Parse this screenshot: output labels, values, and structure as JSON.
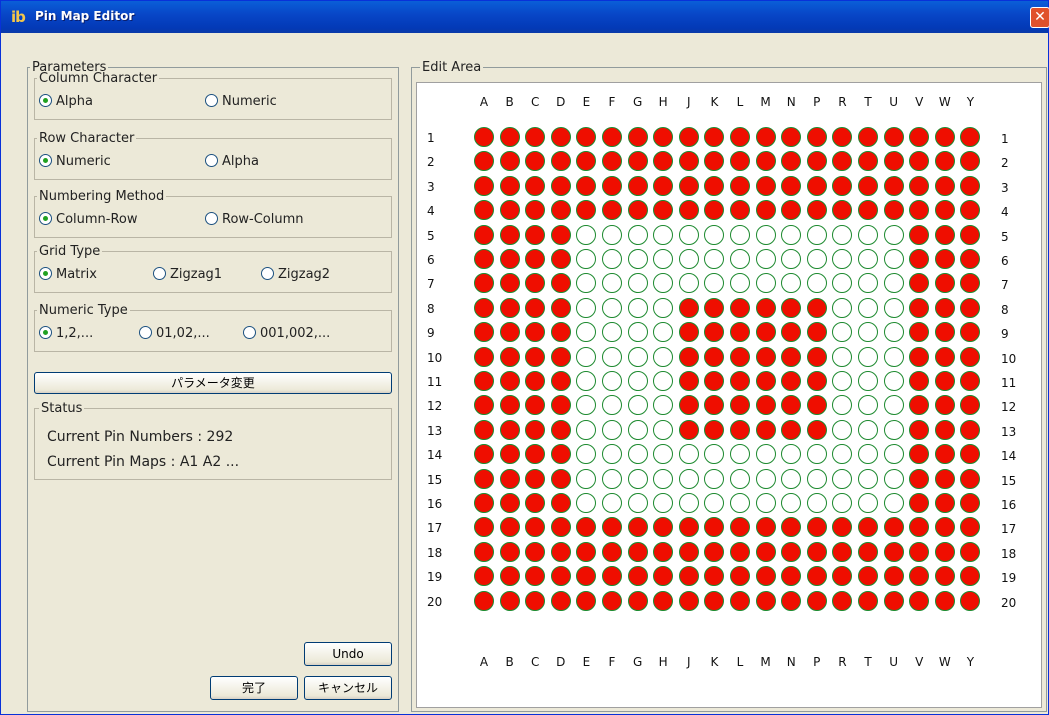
{
  "window": {
    "title": "Pin Map Editor",
    "icon_text": "ib",
    "close_label": "✕"
  },
  "parameters": {
    "legend": "Parameters",
    "groups": [
      {
        "legend": "Column Character",
        "options": [
          "Alpha",
          "Numeric"
        ],
        "selected": 0
      },
      {
        "legend": "Row Character",
        "options": [
          "Numeric",
          "Alpha"
        ],
        "selected": 0
      },
      {
        "legend": "Numbering Method",
        "options": [
          "Column-Row",
          "Row-Column"
        ],
        "selected": 0
      },
      {
        "legend": "Grid Type",
        "options": [
          "Matrix",
          "Zigzag1",
          "Zigzag2"
        ],
        "selected": 0
      },
      {
        "legend": "Numeric Type",
        "options": [
          "1,2,...",
          "01,02,...",
          "001,002,..."
        ],
        "selected": 0
      }
    ],
    "change_button": "パラメータ変更",
    "status": {
      "legend": "Status",
      "pin_numbers": "Current Pin Numbers : 292",
      "pin_maps": "Current Pin Maps :   A1 A2 ..."
    },
    "undo_button": "Undo",
    "done_button": "完了",
    "cancel_button": "キャンセル"
  },
  "edit_area": {
    "legend": "Edit Area",
    "columns": [
      "A",
      "B",
      "C",
      "D",
      "E",
      "F",
      "G",
      "H",
      "J",
      "K",
      "L",
      "M",
      "N",
      "P",
      "R",
      "T",
      "U",
      "V",
      "W",
      "Y"
    ],
    "rows": [
      "1",
      "2",
      "3",
      "4",
      "5",
      "6",
      "7",
      "8",
      "9",
      "10",
      "11",
      "12",
      "13",
      "14",
      "15",
      "16",
      "17",
      "18",
      "19",
      "20"
    ],
    "filled_rows": [
      "11111111111111111111",
      "11111111111111111111",
      "11111111111111111111",
      "11111111111111111111",
      "11110000000000000111",
      "11110000000000000111",
      "11110000000000000111",
      "11110000111111000111",
      "11110000111111000111",
      "11110000111111000111",
      "11110000111111000111",
      "11110000111111000111",
      "11110000111111000111",
      "11110000000000000111",
      "11110000000000000111",
      "11110000000000000111",
      "11111111111111111111",
      "11111111111111111111",
      "11111111111111111111",
      "11111111111111111111"
    ],
    "filled_color": "#ef0e00",
    "pin_border_color": "#1d8a2f"
  }
}
